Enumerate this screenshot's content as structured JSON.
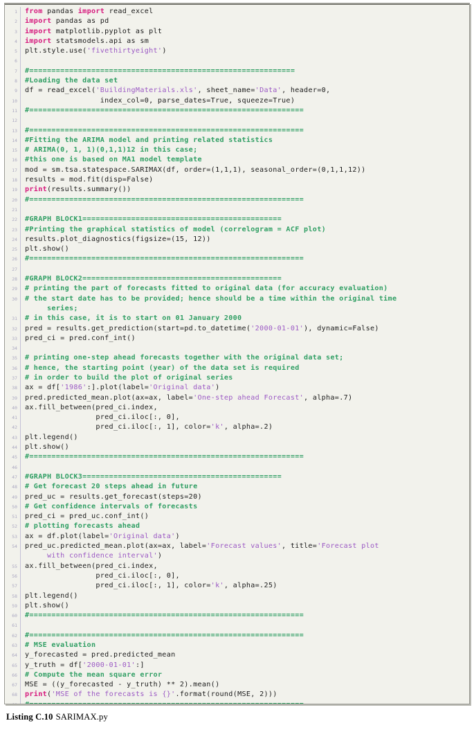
{
  "listing": {
    "language": "python",
    "colors": {
      "keyword": "#d6197d",
      "string": "#9b59c4",
      "comment": "#2f9e63",
      "plain": "#1a1a1a",
      "line_number": "#a9a6c0",
      "background": "#f2f2ec",
      "border": "#9a9a93"
    },
    "lines": [
      {
        "n": "1",
        "tokens": [
          {
            "t": "kw",
            "v": "from"
          },
          {
            "t": "plain",
            "v": " pandas "
          },
          {
            "t": "kw",
            "v": "import"
          },
          {
            "t": "plain",
            "v": " read_excel"
          }
        ]
      },
      {
        "n": "2",
        "tokens": [
          {
            "t": "kw",
            "v": "import"
          },
          {
            "t": "plain",
            "v": " pandas as pd"
          }
        ]
      },
      {
        "n": "3",
        "tokens": [
          {
            "t": "kw",
            "v": "import"
          },
          {
            "t": "plain",
            "v": " matplotlib.pyplot as plt"
          }
        ]
      },
      {
        "n": "4",
        "tokens": [
          {
            "t": "kw",
            "v": "import"
          },
          {
            "t": "plain",
            "v": " statsmodels.api as sm"
          }
        ]
      },
      {
        "n": "5",
        "tokens": [
          {
            "t": "plain",
            "v": "plt.style.use("
          },
          {
            "t": "str",
            "v": "'fivethirtyeight'"
          },
          {
            "t": "plain",
            "v": ")"
          }
        ]
      },
      {
        "n": "6",
        "tokens": []
      },
      {
        "n": "7",
        "tokens": [
          {
            "t": "cmt",
            "v": "#============================================================"
          }
        ]
      },
      {
        "n": "8",
        "tokens": [
          {
            "t": "cmt",
            "v": "#Loading the data set"
          }
        ]
      },
      {
        "n": "9",
        "tokens": [
          {
            "t": "plain",
            "v": "df = read_excel("
          },
          {
            "t": "str",
            "v": "'BuildingMaterials.xls'"
          },
          {
            "t": "plain",
            "v": ", sheet_name="
          },
          {
            "t": "str",
            "v": "'Data'"
          },
          {
            "t": "plain",
            "v": ", header=0,"
          }
        ]
      },
      {
        "n": "10",
        "tokens": [
          {
            "t": "plain",
            "v": "                 index_col=0, parse_dates=True, squeeze=True)"
          }
        ]
      },
      {
        "n": "11",
        "tokens": [
          {
            "t": "cmt",
            "v": "#=============================================================="
          }
        ]
      },
      {
        "n": "12",
        "tokens": []
      },
      {
        "n": "13",
        "tokens": [
          {
            "t": "cmt",
            "v": "#=============================================================="
          }
        ]
      },
      {
        "n": "14",
        "tokens": [
          {
            "t": "cmt",
            "v": "#Fitting the ARIMA model and printing related statistics"
          }
        ]
      },
      {
        "n": "15",
        "tokens": [
          {
            "t": "cmt",
            "v": "# ARIMA(0, 1, 1)(0,1,1)12 in this case;"
          }
        ]
      },
      {
        "n": "16",
        "tokens": [
          {
            "t": "cmt",
            "v": "#this one is based on MA1 model template"
          }
        ]
      },
      {
        "n": "17",
        "tokens": [
          {
            "t": "plain",
            "v": "mod = sm.tsa.statespace.SARIMAX(df, order=(1,1,1), seasonal_order=(0,1,1,12))"
          }
        ]
      },
      {
        "n": "18",
        "tokens": [
          {
            "t": "plain",
            "v": "results = mod.fit(disp=False)"
          }
        ]
      },
      {
        "n": "19",
        "tokens": [
          {
            "t": "kw",
            "v": "print"
          },
          {
            "t": "plain",
            "v": "(results.summary())"
          }
        ]
      },
      {
        "n": "20",
        "tokens": [
          {
            "t": "cmt",
            "v": "#=============================================================="
          }
        ]
      },
      {
        "n": "21",
        "tokens": []
      },
      {
        "n": "22",
        "tokens": [
          {
            "t": "cmt",
            "v": "#GRAPH BLOCK1============================================="
          }
        ]
      },
      {
        "n": "23",
        "tokens": [
          {
            "t": "cmt",
            "v": "#Printing the graphical statistics of model (correlogram = ACF plot)"
          }
        ]
      },
      {
        "n": "24",
        "tokens": [
          {
            "t": "plain",
            "v": "results.plot_diagnostics(figsize=(15, 12))"
          }
        ]
      },
      {
        "n": "25",
        "tokens": [
          {
            "t": "plain",
            "v": "plt.show()"
          }
        ]
      },
      {
        "n": "26",
        "tokens": [
          {
            "t": "cmt",
            "v": "#=============================================================="
          }
        ]
      },
      {
        "n": "27",
        "tokens": []
      },
      {
        "n": "28",
        "tokens": [
          {
            "t": "cmt",
            "v": "#GRAPH BLOCK2============================================="
          }
        ]
      },
      {
        "n": "29",
        "tokens": [
          {
            "t": "cmt",
            "v": "# printing the part of forecasts fitted to original data (for accuracy evaluation)"
          }
        ]
      },
      {
        "n": "30",
        "tokens": [
          {
            "t": "cmt",
            "v": "# the start date has to be provided; hence should be a time within the original time"
          }
        ]
      },
      {
        "n": "",
        "tokens": [
          {
            "t": "cmt",
            "v": "     series;"
          }
        ]
      },
      {
        "n": "31",
        "tokens": [
          {
            "t": "cmt",
            "v": "# in this case, it is to start on 01 January 2000"
          }
        ]
      },
      {
        "n": "32",
        "tokens": [
          {
            "t": "plain",
            "v": "pred = results.get_prediction(start=pd.to_datetime("
          },
          {
            "t": "str",
            "v": "'2000-01-01'"
          },
          {
            "t": "plain",
            "v": "), dynamic=False)"
          }
        ]
      },
      {
        "n": "33",
        "tokens": [
          {
            "t": "plain",
            "v": "pred_ci = pred.conf_int()"
          }
        ]
      },
      {
        "n": "34",
        "tokens": []
      },
      {
        "n": "35",
        "tokens": [
          {
            "t": "cmt",
            "v": "# printing one-step ahead forecasts together with the original data set;"
          }
        ]
      },
      {
        "n": "36",
        "tokens": [
          {
            "t": "cmt",
            "v": "# hence, the starting point (year) of the data set is required"
          }
        ]
      },
      {
        "n": "37",
        "tokens": [
          {
            "t": "cmt",
            "v": "# in order to build the plot of original series"
          }
        ]
      },
      {
        "n": "38",
        "tokens": [
          {
            "t": "plain",
            "v": "ax = df["
          },
          {
            "t": "str",
            "v": "'1986'"
          },
          {
            "t": "plain",
            "v": ":].plot(label="
          },
          {
            "t": "str",
            "v": "'Original data'"
          },
          {
            "t": "plain",
            "v": ")"
          }
        ]
      },
      {
        "n": "39",
        "tokens": [
          {
            "t": "plain",
            "v": "pred.predicted_mean.plot(ax=ax, label="
          },
          {
            "t": "str",
            "v": "'One-step ahead Forecast'"
          },
          {
            "t": "plain",
            "v": ", alpha=.7)"
          }
        ]
      },
      {
        "n": "40",
        "tokens": [
          {
            "t": "plain",
            "v": "ax.fill_between(pred_ci.index,"
          }
        ]
      },
      {
        "n": "41",
        "tokens": [
          {
            "t": "plain",
            "v": "                pred_ci.iloc[:, 0],"
          }
        ]
      },
      {
        "n": "42",
        "tokens": [
          {
            "t": "plain",
            "v": "                pred_ci.iloc[:, 1], color="
          },
          {
            "t": "str",
            "v": "'k'"
          },
          {
            "t": "plain",
            "v": ", alpha=.2)"
          }
        ]
      },
      {
        "n": "43",
        "tokens": [
          {
            "t": "plain",
            "v": "plt.legend()"
          }
        ]
      },
      {
        "n": "44",
        "tokens": [
          {
            "t": "plain",
            "v": "plt.show()"
          }
        ]
      },
      {
        "n": "45",
        "tokens": [
          {
            "t": "cmt",
            "v": "#=============================================================="
          }
        ]
      },
      {
        "n": "46",
        "tokens": []
      },
      {
        "n": "47",
        "tokens": [
          {
            "t": "cmt",
            "v": "#GRAPH BLOCK3============================================="
          }
        ]
      },
      {
        "n": "48",
        "tokens": [
          {
            "t": "cmt",
            "v": "# Get forecast 20 steps ahead in future"
          }
        ]
      },
      {
        "n": "49",
        "tokens": [
          {
            "t": "plain",
            "v": "pred_uc = results.get_forecast(steps=20)"
          }
        ]
      },
      {
        "n": "50",
        "tokens": [
          {
            "t": "cmt",
            "v": "# Get confidence intervals of forecasts"
          }
        ]
      },
      {
        "n": "51",
        "tokens": [
          {
            "t": "plain",
            "v": "pred_ci = pred_uc.conf_int()"
          }
        ]
      },
      {
        "n": "52",
        "tokens": [
          {
            "t": "cmt",
            "v": "# plotting forecasts ahead"
          }
        ]
      },
      {
        "n": "53",
        "tokens": [
          {
            "t": "plain",
            "v": "ax = df.plot(label="
          },
          {
            "t": "str",
            "v": "'Original data'"
          },
          {
            "t": "plain",
            "v": ")"
          }
        ]
      },
      {
        "n": "54",
        "tokens": [
          {
            "t": "plain",
            "v": "pred_uc.predicted_mean.plot(ax=ax, label="
          },
          {
            "t": "str",
            "v": "'Forecast values'"
          },
          {
            "t": "plain",
            "v": ", title="
          },
          {
            "t": "str",
            "v": "'Forecast plot"
          }
        ]
      },
      {
        "n": "",
        "tokens": [
          {
            "t": "str",
            "v": "     with confidence interval'"
          },
          {
            "t": "plain",
            "v": ")"
          }
        ]
      },
      {
        "n": "55",
        "tokens": [
          {
            "t": "plain",
            "v": "ax.fill_between(pred_ci.index,"
          }
        ]
      },
      {
        "n": "56",
        "tokens": [
          {
            "t": "plain",
            "v": "                pred_ci.iloc[:, 0],"
          }
        ]
      },
      {
        "n": "57",
        "tokens": [
          {
            "t": "plain",
            "v": "                pred_ci.iloc[:, 1], color="
          },
          {
            "t": "str",
            "v": "'k'"
          },
          {
            "t": "plain",
            "v": ", alpha=.25)"
          }
        ]
      },
      {
        "n": "58",
        "tokens": [
          {
            "t": "plain",
            "v": "plt.legend()"
          }
        ]
      },
      {
        "n": "59",
        "tokens": [
          {
            "t": "plain",
            "v": "plt.show()"
          }
        ]
      },
      {
        "n": "60",
        "tokens": [
          {
            "t": "cmt",
            "v": "#=============================================================="
          }
        ]
      },
      {
        "n": "61",
        "tokens": []
      },
      {
        "n": "62",
        "tokens": [
          {
            "t": "cmt",
            "v": "#=============================================================="
          }
        ]
      },
      {
        "n": "63",
        "tokens": [
          {
            "t": "cmt",
            "v": "# MSE evaluation"
          }
        ]
      },
      {
        "n": "64",
        "tokens": [
          {
            "t": "plain",
            "v": "y_forecasted = pred.predicted_mean"
          }
        ]
      },
      {
        "n": "65",
        "tokens": [
          {
            "t": "plain",
            "v": "y_truth = df["
          },
          {
            "t": "str",
            "v": "'2000-01-01'"
          },
          {
            "t": "plain",
            "v": ":]"
          }
        ]
      },
      {
        "n": "66",
        "tokens": [
          {
            "t": "cmt",
            "v": "# Compute the mean square error"
          }
        ]
      },
      {
        "n": "67",
        "tokens": [
          {
            "t": "plain",
            "v": "MSE = ((y_forecasted - y_truth) ** 2).mean()"
          }
        ]
      },
      {
        "n": "68",
        "tokens": [
          {
            "t": "kw",
            "v": "print"
          },
          {
            "t": "plain",
            "v": "("
          },
          {
            "t": "str",
            "v": "'MSE of the forecasts is {}'"
          },
          {
            "t": "plain",
            "v": ".format(round(MSE, 2)))"
          }
        ]
      },
      {
        "n": "69",
        "tokens": [
          {
            "t": "cmt",
            "v": "#=============================================================="
          }
        ]
      }
    ]
  },
  "caption": {
    "label": "Listing C.10",
    "title": "SARIMAX.py"
  }
}
